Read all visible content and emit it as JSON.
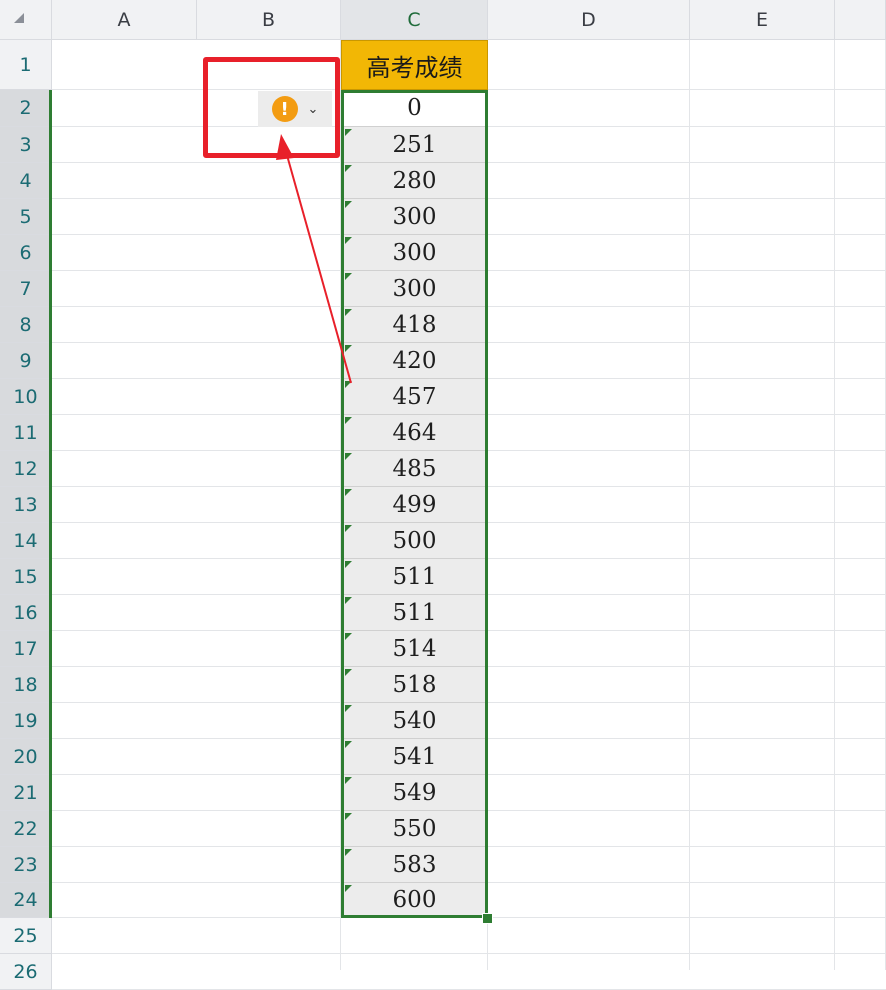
{
  "columns": [
    "A",
    "B",
    "C",
    "D",
    "E"
  ],
  "rows": [
    "1",
    "2",
    "3",
    "4",
    "5",
    "6",
    "7",
    "8",
    "9",
    "10",
    "11",
    "12",
    "13",
    "14",
    "15",
    "16",
    "17",
    "18",
    "19",
    "20",
    "21",
    "22",
    "23",
    "24",
    "25",
    "26"
  ],
  "header_cell": "高考成绩",
  "scores": [
    "0",
    "251",
    "280",
    "300",
    "300",
    "300",
    "418",
    "420",
    "457",
    "464",
    "485",
    "499",
    "500",
    "511",
    "511",
    "514",
    "518",
    "540",
    "541",
    "549",
    "550",
    "583",
    "600"
  ],
  "error_button": {
    "icon": "!",
    "chevron": "⌄"
  },
  "colors": {
    "header_fill": "#f2b705",
    "selection": "#2e7d32",
    "annotation": "#e8202a",
    "warning": "#f39c12"
  }
}
